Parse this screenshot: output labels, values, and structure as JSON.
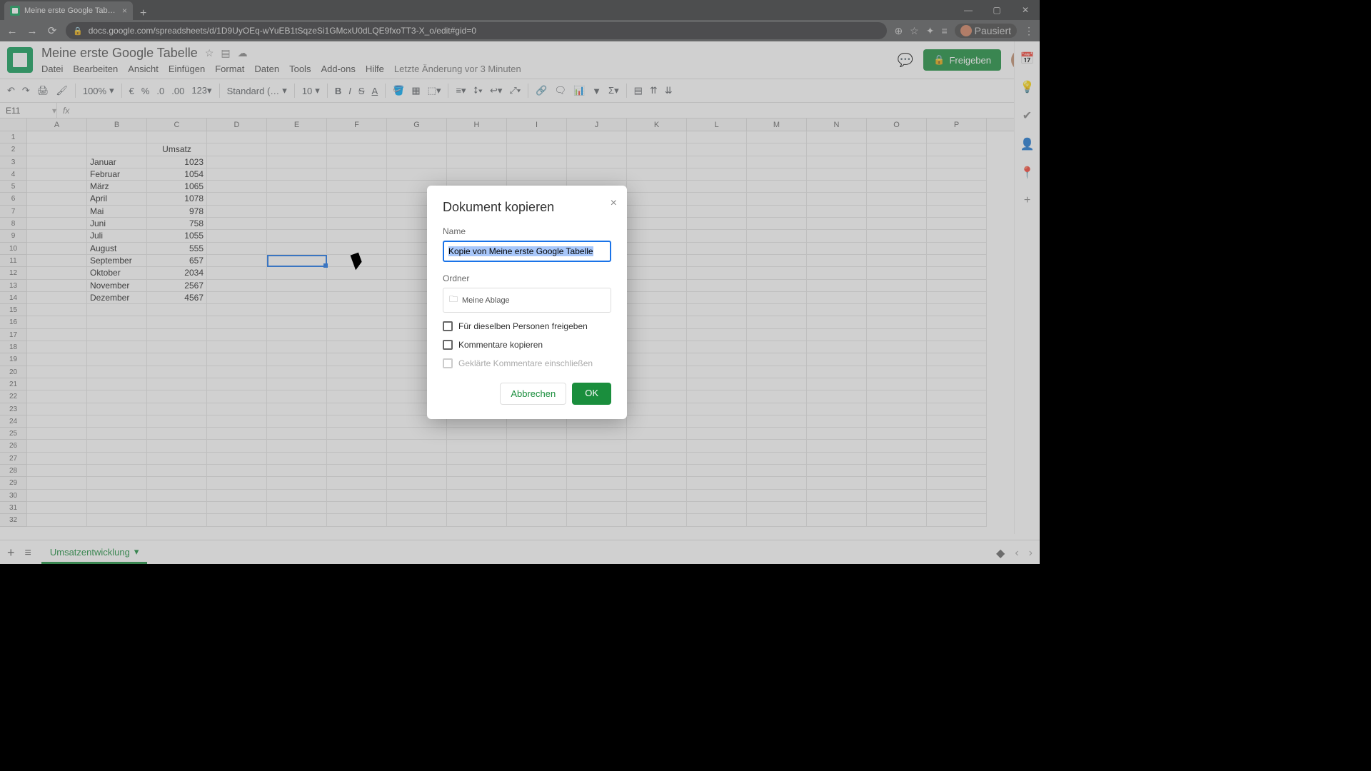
{
  "browser": {
    "tab_title": "Meine erste Google Tabelle - Go",
    "url": "docs.google.com/spreadsheets/d/1D9UyOEq-wYuEB1tSqzeSi1GMcxU0dLQE9fxoTT3-X_o/edit#gid=0",
    "paused_label": "Pausiert"
  },
  "header": {
    "doc_title": "Meine erste Google Tabelle",
    "menus": [
      "Datei",
      "Bearbeiten",
      "Ansicht",
      "Einfügen",
      "Format",
      "Daten",
      "Tools",
      "Add-ons",
      "Hilfe"
    ],
    "last_edit": "Letzte Änderung vor 3 Minuten",
    "share_label": "Freigeben"
  },
  "toolbar": {
    "zoom": "100%",
    "currency": "€",
    "percent": "%",
    "dec_less": ".0",
    "dec_more": ".00",
    "numfmt": "123",
    "fontname": "Standard (…",
    "fontsize": "10"
  },
  "formula_bar": {
    "cell_ref": "E11"
  },
  "columns": [
    "A",
    "B",
    "C",
    "D",
    "E",
    "F",
    "G",
    "H",
    "I",
    "J",
    "K",
    "L",
    "M",
    "N",
    "O",
    "P"
  ],
  "row_count": 32,
  "data_rows": [
    {
      "r": 2,
      "C": "Umsatz"
    },
    {
      "r": 3,
      "B": "Januar",
      "C": "1023"
    },
    {
      "r": 4,
      "B": "Februar",
      "C": "1054"
    },
    {
      "r": 5,
      "B": "März",
      "C": "1065"
    },
    {
      "r": 6,
      "B": "April",
      "C": "1078"
    },
    {
      "r": 7,
      "B": "Mai",
      "C": "978"
    },
    {
      "r": 8,
      "B": "Juni",
      "C": "758"
    },
    {
      "r": 9,
      "B": "Juli",
      "C": "1055"
    },
    {
      "r": 10,
      "B": "August",
      "C": "555"
    },
    {
      "r": 11,
      "B": "September",
      "C": "657"
    },
    {
      "r": 12,
      "B": "Oktober",
      "C": "2034"
    },
    {
      "r": 13,
      "B": "November",
      "C": "2567"
    },
    {
      "r": 14,
      "B": "Dezember",
      "C": "4567"
    }
  ],
  "sheet_tab": "Umsatzentwicklung",
  "dialog": {
    "title": "Dokument kopieren",
    "name_label": "Name",
    "name_value": "Kopie von Meine erste Google Tabelle",
    "folder_label": "Ordner",
    "folder_value": "Meine Ablage",
    "chk_share": "Für dieselben Personen freigeben",
    "chk_comments": "Kommentare kopieren",
    "chk_resolved": "Geklärte Kommentare einschließen",
    "cancel": "Abbrechen",
    "ok": "OK"
  }
}
